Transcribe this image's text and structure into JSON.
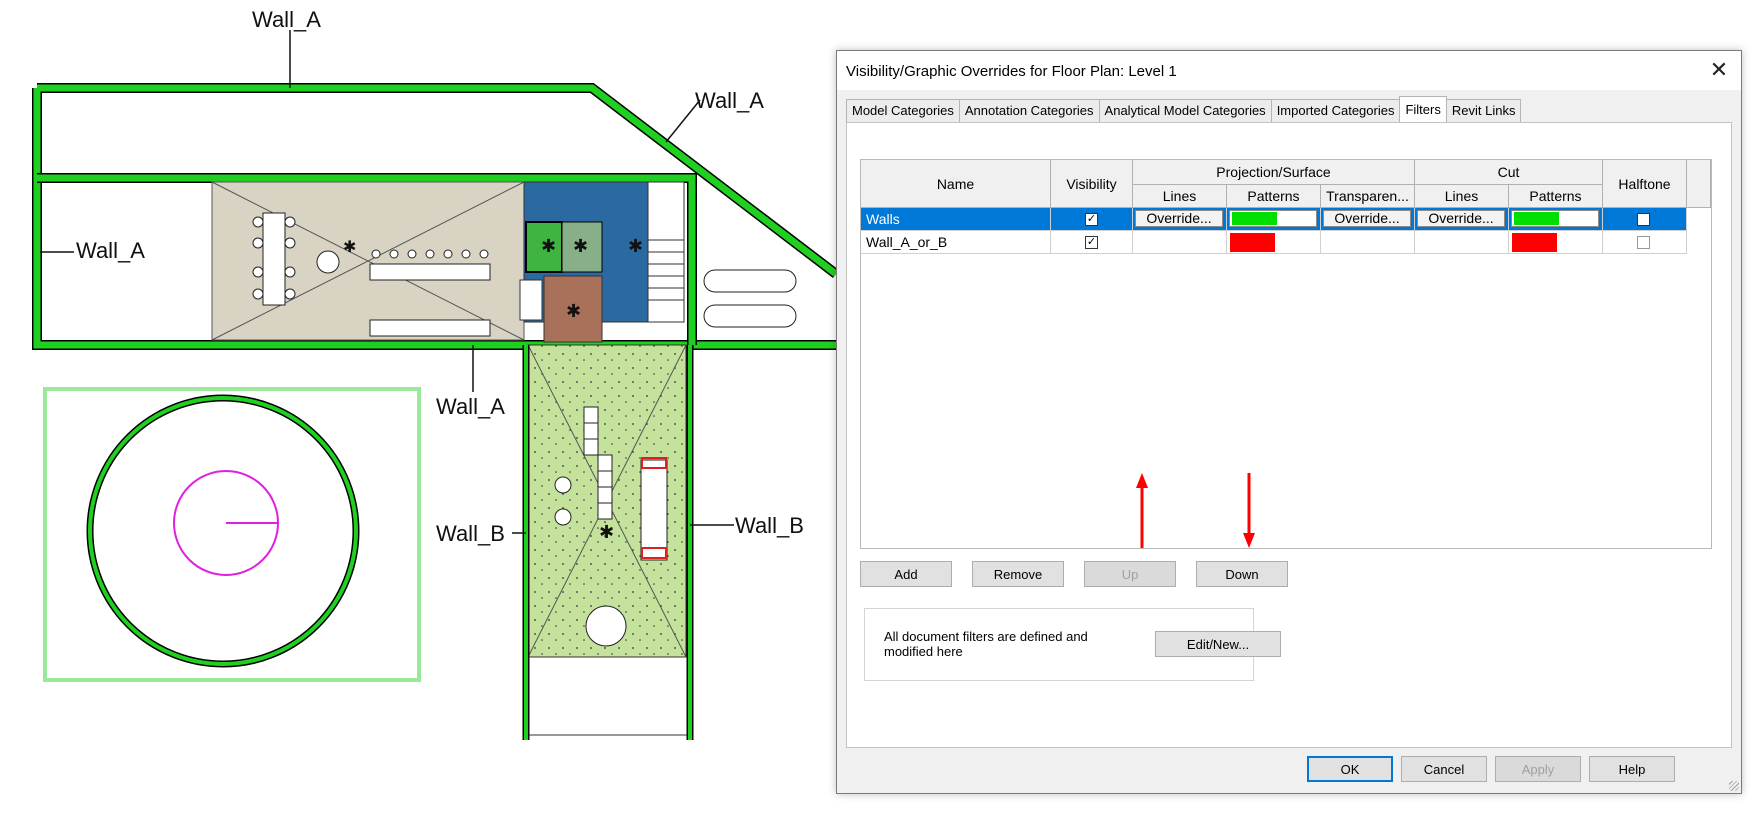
{
  "plan": {
    "wall_labels": [
      "Wall_A",
      "Wall_A",
      "Wall_A",
      "Wall_A",
      "Wall_B",
      "Wall_B"
    ]
  },
  "dialog": {
    "title": "Visibility/Graphic Overrides for Floor Plan: Level 1",
    "close_glyph": "✕",
    "tabs": [
      {
        "label": "Model Categories",
        "active": false
      },
      {
        "label": "Annotation Categories",
        "active": false
      },
      {
        "label": "Analytical Model Categories",
        "active": false
      },
      {
        "label": "Imported Categories",
        "active": false
      },
      {
        "label": "Filters",
        "active": true
      },
      {
        "label": "Revit Links",
        "active": false
      }
    ],
    "table": {
      "headers": {
        "name": "Name",
        "visibility": "Visibility",
        "projection_surface": "Projection/Surface",
        "cut": "Cut",
        "halftone": "Halftone",
        "lines": "Lines",
        "patterns": "Patterns",
        "transparency": "Transparen...",
        "cut_lines": "Lines",
        "cut_patterns": "Patterns"
      },
      "rows": [
        {
          "name": "Walls",
          "selected": true,
          "visible": true,
          "projection_lines": "Override...",
          "projection_pattern_color": "#00dd00",
          "transparency": "Override...",
          "cut_lines": "Override...",
          "cut_pattern_color": "#00dd00",
          "halftone": false
        },
        {
          "name": "Wall_A_or_B",
          "selected": false,
          "visible": true,
          "projection_lines": "",
          "projection_pattern_color": "#ff0000",
          "transparency": "",
          "cut_lines": "",
          "cut_pattern_color": "#ff0000",
          "halftone": false
        }
      ]
    },
    "buttons": {
      "add": "Add",
      "remove": "Remove",
      "up": "Up",
      "down": "Down",
      "edit_new": "Edit/New...",
      "ok": "OK",
      "cancel": "Cancel",
      "apply": "Apply",
      "help": "Help"
    },
    "info_text": "All document filters are defined and modified here",
    "colors": {
      "selection": "#0078d7",
      "annotation_arrow": "#ff0000"
    }
  }
}
